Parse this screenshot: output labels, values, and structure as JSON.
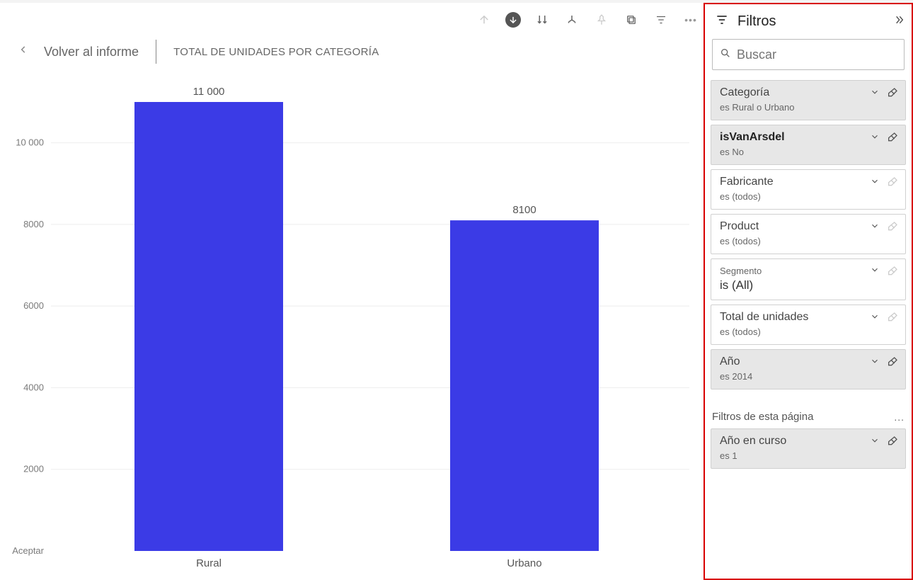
{
  "header": {
    "back_label": "Volver al informe",
    "title": "TOTAL DE UNIDADES POR CATEGORÍA"
  },
  "chart_data": {
    "type": "bar",
    "categories": [
      "Rural",
      "Urbano"
    ],
    "values": [
      11000,
      8100
    ],
    "value_labels": [
      "11 000",
      "8100"
    ],
    "title": "TOTAL DE UNIDADES POR CATEGORÍA",
    "xlabel": "",
    "ylabel": "Aceptar",
    "ylim": [
      0,
      11000
    ],
    "yticks": [
      2000,
      4000,
      6000,
      8000,
      10000
    ],
    "ytick_labels": [
      "2000",
      "4000",
      "6000",
      "8000",
      "10 000"
    ]
  },
  "filters": {
    "title": "Filtros",
    "search_placeholder": "Buscar",
    "section_pagelevel": "Filtros de esta página",
    "cards": [
      {
        "name": "Categoría",
        "sub": "es Rural o Urbano",
        "active": true,
        "bold": false,
        "big_sub": false
      },
      {
        "name": "isVanArsdel",
        "sub": "es No",
        "active": true,
        "bold": true,
        "big_sub": false
      },
      {
        "name": "Fabricante",
        "sub": "es (todos)",
        "active": false,
        "bold": false,
        "big_sub": false
      },
      {
        "name": "Product",
        "sub": "es (todos)",
        "active": false,
        "bold": false,
        "big_sub": false
      },
      {
        "name": "Segmento",
        "sub": "is (All)",
        "active": false,
        "bold": false,
        "big_sub": true
      },
      {
        "name": "Total de unidades",
        "sub": "es (todos)",
        "active": false,
        "bold": false,
        "big_sub": false
      },
      {
        "name": "Año",
        "sub": "es 2014",
        "active": true,
        "bold": false,
        "big_sub": false
      }
    ],
    "page_cards": [
      {
        "name": "Año en curso",
        "sub": "es 1",
        "active": true,
        "bold": false
      }
    ]
  }
}
